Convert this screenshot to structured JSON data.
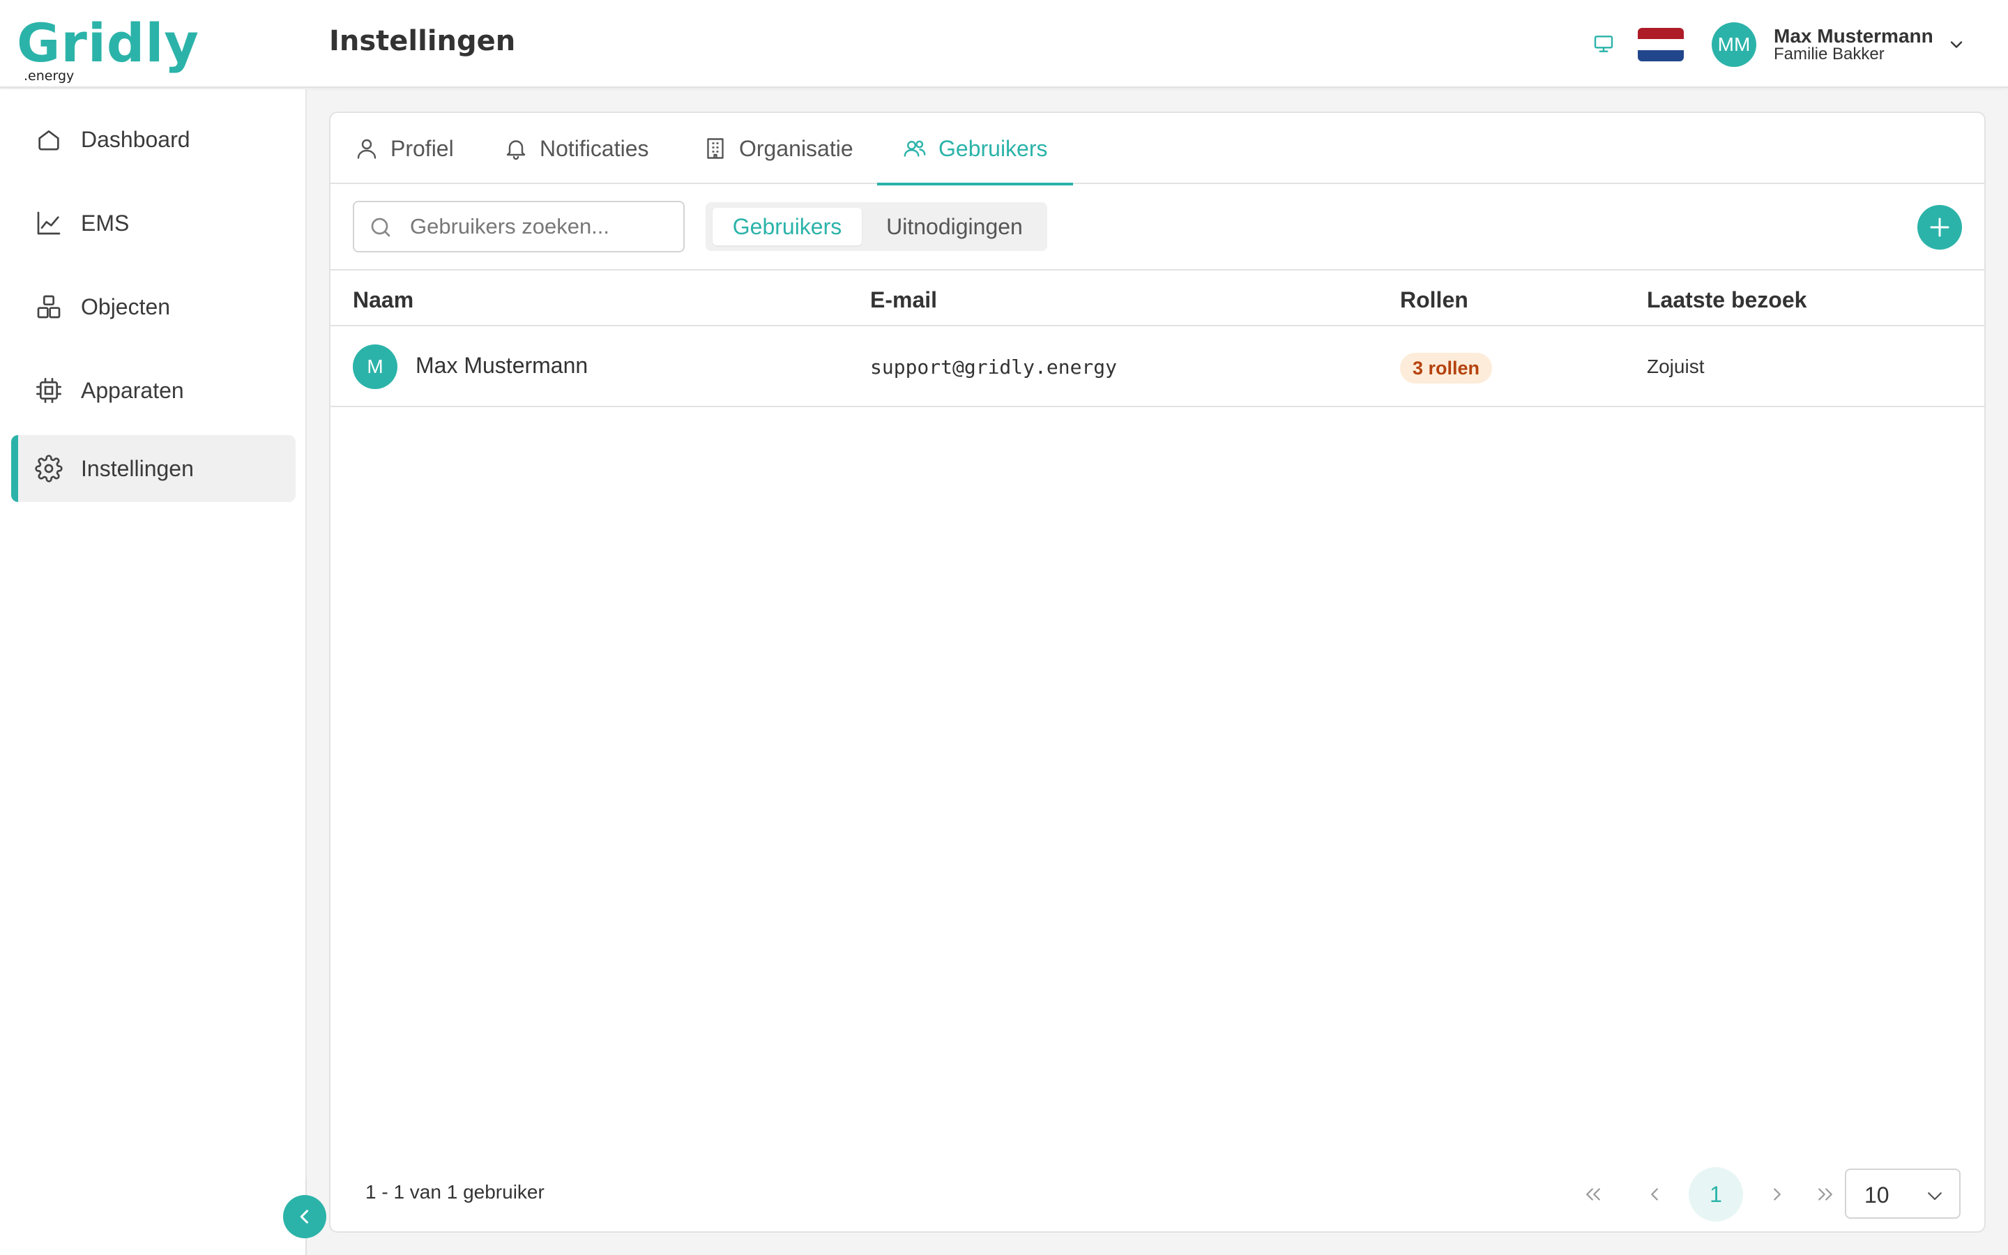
{
  "brand": {
    "logo_main": "Gridly",
    "logo_sub": ".energy",
    "accent": "#2bb3a9"
  },
  "header": {
    "title": "Instellingen",
    "user": {
      "initials": "MM",
      "name": "Max Mustermann",
      "organization": "Familie Bakker"
    }
  },
  "sidebar": {
    "items": [
      {
        "label": "Dashboard",
        "icon": "home-icon"
      },
      {
        "label": "EMS",
        "icon": "chart-line-icon"
      },
      {
        "label": "Objecten",
        "icon": "boxes-icon"
      },
      {
        "label": "Apparaten",
        "icon": "chip-icon"
      },
      {
        "label": "Instellingen",
        "icon": "gear-icon",
        "active": true
      }
    ]
  },
  "tabs": [
    {
      "label": "Profiel",
      "icon": "user-icon"
    },
    {
      "label": "Notificaties",
      "icon": "bell-icon"
    },
    {
      "label": "Organisatie",
      "icon": "building-icon"
    },
    {
      "label": "Gebruikers",
      "icon": "users-icon",
      "active": true
    }
  ],
  "toolbar": {
    "search_placeholder": "Gebruikers zoeken...",
    "segments": [
      "Gebruikers",
      "Uitnodigingen"
    ],
    "active_segment": "Gebruikers"
  },
  "table": {
    "columns": [
      "Naam",
      "E-mail",
      "Rollen",
      "Laatste bezoek"
    ],
    "rows": [
      {
        "initial": "M",
        "name": "Max Mustermann",
        "email": "support@gridly.energy",
        "roles": "3 rollen",
        "last_visit": "Zojuist"
      }
    ]
  },
  "pagination": {
    "summary": "1 - 1 van 1 gebruiker",
    "current_page": "1",
    "per_page": "10"
  }
}
